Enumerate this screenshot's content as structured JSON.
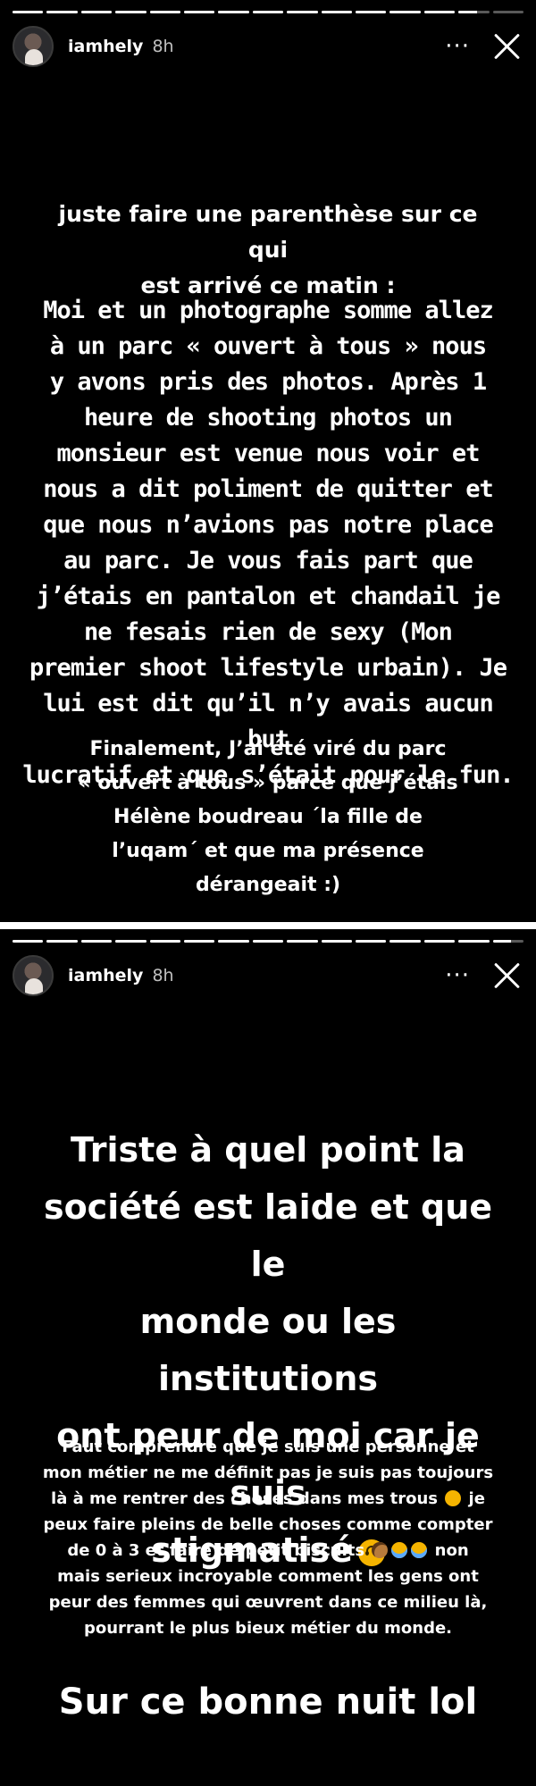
{
  "stories": [
    {
      "header": {
        "username": "iamhely",
        "time": "8h",
        "more_label": "···"
      },
      "progress_segments": 15,
      "progress_current": 13,
      "lead_text": "juste faire une parenthèse sur ce qui\nest arrivé ce matin :",
      "body_text": "Moi et un photographe somme allez\nà un parc « ouvert à tous » nous\ny avons pris des photos. Après 1\nheure de shooting photos un\nmonsieur est venue nous voir et\nnous a dit poliment de quitter et\nque nous n’avions pas notre place\nau parc. Je vous fais part que\nj’étais en pantalon et chandail je\nne fesais rien de sexy (Mon\npremier shoot lifestyle urbain). Je\nlui est dit qu’il n’y avais aucun but\nlucratif et que s’était pour le fun.",
      "final_text": "Finalement, J’ai été viré du parc\n« ouvert à tous » parce que j’étais\nHélène boudreau ´la fille de\nl’uqam´ et que ma présence\ndérangeait :)"
    },
    {
      "header": {
        "username": "iamhely",
        "time": "8h",
        "more_label": "···"
      },
      "progress_segments": 15,
      "progress_current": 14,
      "big_text": "Triste à quel point la\nsociété est laide et que le\nmonde ou les institutions\nont peur de moi car je suis\nstigmatisé",
      "small_text_1": "Faut comprendre que je suis une personne et\nmon métier ne me définit pas je suis pas toujours\nlà à me rentrer des choses dans mes trous",
      "small_text_2": "je\npeux faire pleins de belle choses comme compter\nde 0 à 3 et faire de petit biscuits",
      "small_text_3": "non\nmais serieux incroyable comment les gens ont\npeur des femmes qui œuvrent dans ce milieu là,\npourrant le plus bieux métier du monde.",
      "closing_text": "Sur ce bonne nuit lol"
    }
  ],
  "icons": {
    "avatar": "profile-photo",
    "more": "more-horizontal-icon",
    "close": "close-x-icon",
    "emoji_upside_down": "upside-down-face-emoji",
    "emoji_smile": "slight-smile-emoji",
    "emoji_cookie": "cookie-emoji",
    "emoji_laugh": "tears-of-joy-emoji"
  },
  "colors": {
    "background": "#000000",
    "text": "#ffffff",
    "divider": "#ffffff"
  }
}
